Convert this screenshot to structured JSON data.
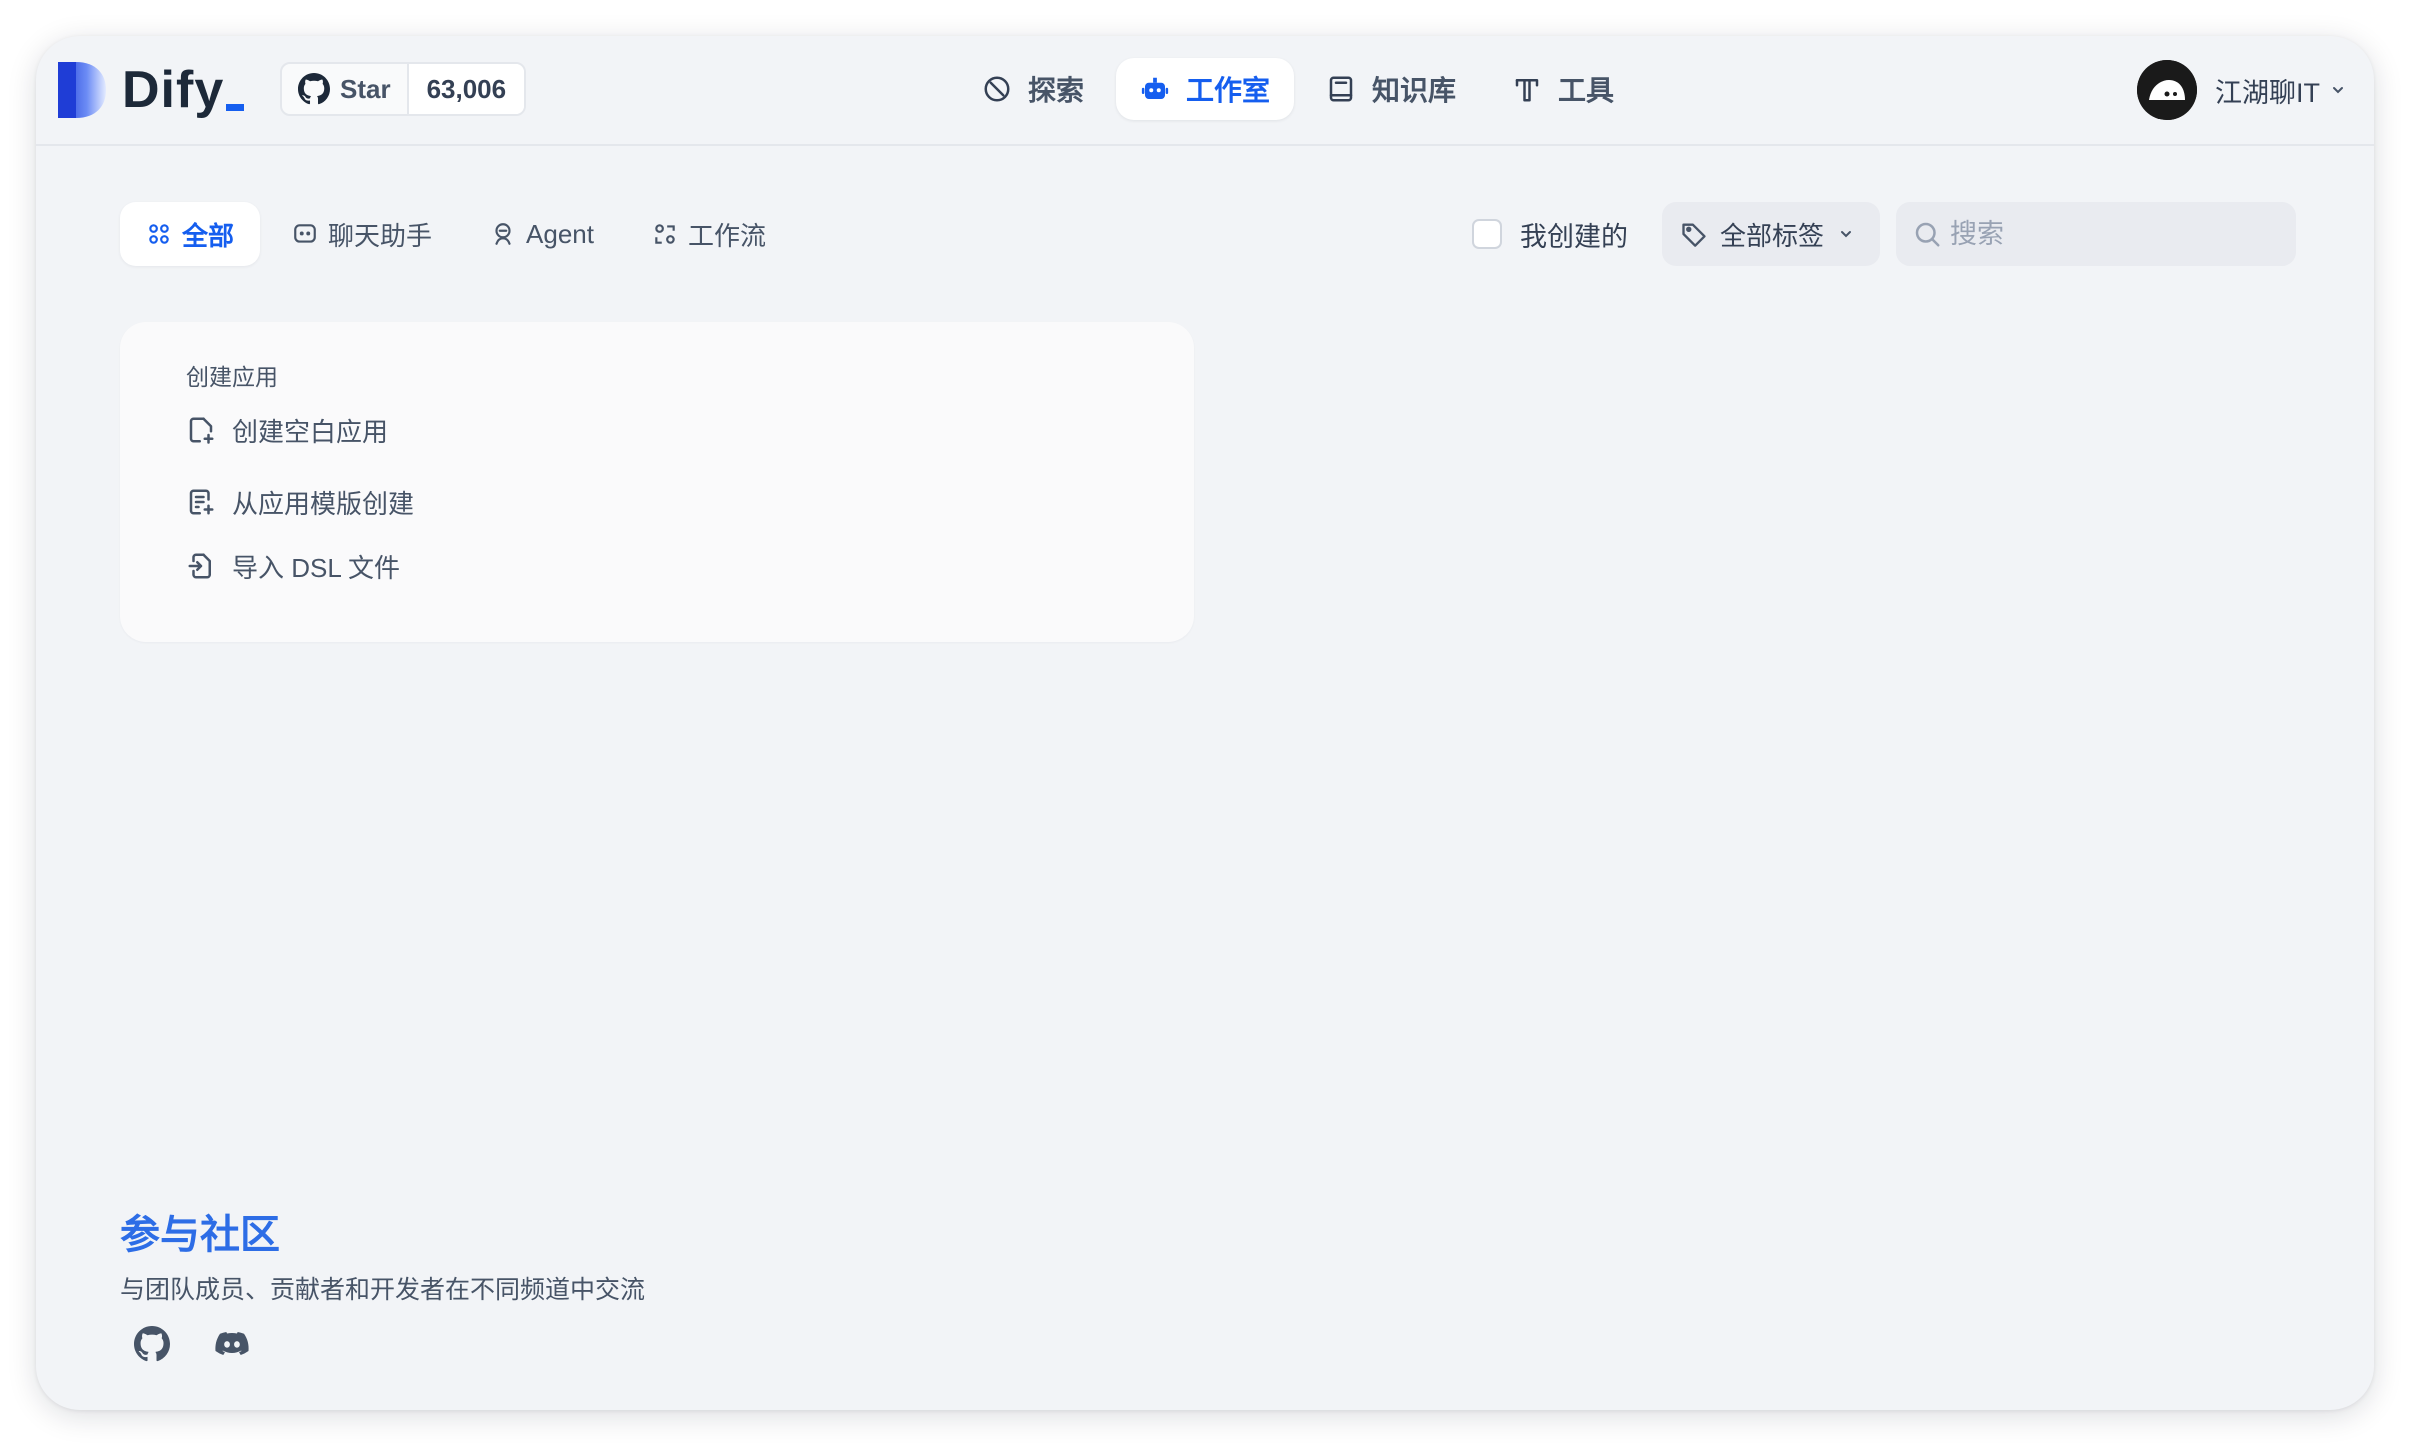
{
  "app": {
    "logo_text": "Dify"
  },
  "github": {
    "star_label": "Star",
    "star_count": "63,006"
  },
  "nav": {
    "items": [
      {
        "label": "探索",
        "icon": "explore-icon",
        "active": false
      },
      {
        "label": "工作室",
        "icon": "robot-icon",
        "active": true
      },
      {
        "label": "知识库",
        "icon": "book-icon",
        "active": false
      },
      {
        "label": "工具",
        "icon": "tools-icon",
        "active": false
      }
    ]
  },
  "user": {
    "name": "江湖聊IT"
  },
  "tabs": [
    {
      "label": "全部",
      "icon": "grid-icon",
      "active": true
    },
    {
      "label": "聊天助手",
      "icon": "chat-icon",
      "active": false
    },
    {
      "label": "Agent",
      "icon": "agent-icon",
      "active": false
    },
    {
      "label": "工作流",
      "icon": "workflow-icon",
      "active": false
    }
  ],
  "filters": {
    "mine_label": "我创建的",
    "mine_checked": false,
    "tag_label": "全部标签",
    "search_placeholder": "搜索"
  },
  "create_card": {
    "title": "创建应用",
    "items": [
      {
        "label": "创建空白应用",
        "icon": "file-plus-icon"
      },
      {
        "label": "从应用模版创建",
        "icon": "template-icon"
      },
      {
        "label": "导入 DSL 文件",
        "icon": "import-icon"
      }
    ]
  },
  "community": {
    "title": "参与社区",
    "subtitle": "与团队成员、贡献者和开发者在不同频道中交流"
  },
  "colors": {
    "accent": "#155eef",
    "community_title": "#2d6de6",
    "window_bg": "#f2f4f7"
  }
}
